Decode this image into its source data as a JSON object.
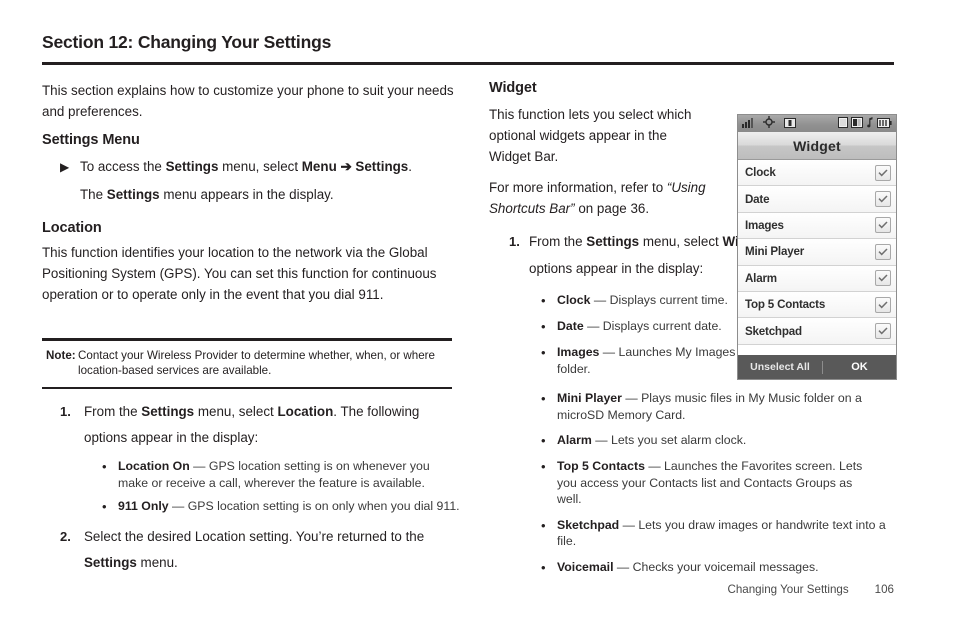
{
  "section": {
    "title": "Section 12: Changing Your Settings"
  },
  "left": {
    "intro": "This section explains how to customize your phone to suit your needs and preferences.",
    "settings_menu": {
      "heading": "Settings Menu",
      "bullet_mark": "▶",
      "line1_a": "To access the ",
      "line1_b": "Settings",
      "line1_c": " menu, select ",
      "line1_d": "Menu",
      "line1_arrow": " ➔ ",
      "line1_e": "Settings",
      "line1_f": ".",
      "line2_a": "The ",
      "line2_b": "Settings",
      "line2_c": " menu appears in the display."
    },
    "location": {
      "heading": "Location",
      "paragraph": "This function identifies your location to the network via the Global Positioning System (GPS). You can set this function for continuous operation or to operate only in the event that you dial 911.",
      "note_label": "Note:",
      "note_text": "Contact your Wireless Provider to determine whether, when, or where location-based services are available.",
      "steps": [
        {
          "num": "1.",
          "a": "From the ",
          "b": "Settings",
          "c": " menu, select ",
          "d": "Location",
          "e": ". The following options appear in the display:"
        },
        {
          "num": "2.",
          "a": "Select the desired Location setting. You’re returned to the ",
          "b": "Settings",
          "c": " menu.",
          "d": "",
          "e": ""
        }
      ],
      "options": [
        {
          "term": "Location On",
          "dash": " — ",
          "desc": "GPS location setting is on whenever you make or receive a call, wherever the feature is available."
        },
        {
          "term": "911 Only",
          "dash": " — ",
          "desc": "GPS location setting is on only when you dial 911."
        }
      ]
    }
  },
  "right": {
    "widget": {
      "heading": "Widget",
      "para1": "This function lets you select which optional widgets appear in the Widget Bar.",
      "para2_a": "For more information, refer to ",
      "para2_italic": "“Using Shortcuts Bar”",
      "para2_b": " on page 36.",
      "step": {
        "num": "1.",
        "a": "From the ",
        "b": "Settings",
        "c": " menu, select ",
        "d": "Widget",
        "e": ". The following options appear in the display:"
      },
      "options": [
        {
          "term": "Clock",
          "dash": " — ",
          "desc": "Displays current time."
        },
        {
          "term": "Date",
          "dash": " — ",
          "desc": "Displays current date."
        },
        {
          "term": "Images",
          "dash": " — ",
          "desc": "Launches My Images folder."
        },
        {
          "term": "Mini Player",
          "dash": " — ",
          "desc": "Plays music files in My Music folder on a microSD Memory Card."
        },
        {
          "term": "Alarm",
          "dash": " — ",
          "desc": "Lets you set alarm clock."
        },
        {
          "term": "Top 5 Contacts",
          "dash": " — ",
          "desc": "Launches the Favorites screen. Lets you access your Contacts list and Contacts Groups as well."
        },
        {
          "term": "Sketchpad",
          "dash": " — ",
          "desc": "Lets you draw images or handwrite text into a file."
        },
        {
          "term": "Voicemail",
          "dash": " — ",
          "desc": "Checks your voicemail messages."
        }
      ]
    }
  },
  "phone_screenshot": {
    "title": "Widget",
    "status_icons_left": [
      "signal-bars-icon",
      "gps-icon",
      "sim-card-icon"
    ],
    "status_icons_right": [
      "message-icon",
      "bluetooth-box-icon",
      "music-note-icon",
      "battery-icon"
    ],
    "rows": [
      {
        "label": "Clock",
        "checked": true
      },
      {
        "label": "Date",
        "checked": true
      },
      {
        "label": "Images",
        "checked": true
      },
      {
        "label": "Mini Player",
        "checked": true
      },
      {
        "label": "Alarm",
        "checked": true
      },
      {
        "label": "Top 5 Contacts",
        "checked": true
      },
      {
        "label": "Sketchpad",
        "checked": true
      }
    ],
    "softkey_left": "Unselect All",
    "softkey_right": "OK"
  },
  "footer": {
    "name": "Changing Your Settings",
    "page": "106"
  }
}
